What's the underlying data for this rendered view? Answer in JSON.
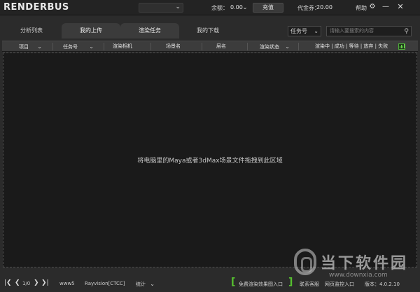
{
  "app": {
    "logo": "RENDERBUS",
    "account_select_value": "",
    "balance_label": "余额：",
    "balance_value": "0.00",
    "recharge_label": "充值",
    "voucher_label": "代金券：",
    "voucher_value": "20.00",
    "help_label": "帮助",
    "icons": [
      "settings-icon",
      "minimize-icon",
      "close-icon"
    ]
  },
  "tabs": [
    {
      "label": "分析列表",
      "active": false
    },
    {
      "label": "我的上传",
      "active": true
    },
    {
      "label": "渲染任务",
      "active": true
    },
    {
      "label": "我的下载",
      "active": false
    }
  ],
  "filter": {
    "select_value": "任务号",
    "search_placeholder": "请输入要搜索的内容"
  },
  "columns": {
    "project": "项目",
    "task_id": "任务号",
    "render_camera": "渲染相机",
    "scene_name": "场景名",
    "layer_name": "层名",
    "render_status": "渲染状态",
    "status_summary": "渲染中 | 成功 | 等待 | 放弃 | 失败"
  },
  "main": {
    "drop_hint": "将电脑里的Maya或者3dMax场景文件拖拽到此区域"
  },
  "statusbar": {
    "page_indicator": "1/0",
    "user": "www5",
    "platform": "Rayvision[CTCC]",
    "stats_label": "统计",
    "free_render_label": "免费渲染效果图入口",
    "contact_label": "联系客服",
    "web_monitor_label": "网页监控入口",
    "version_label": "版本：4.0.2.10"
  },
  "watermark": {
    "text": "当下软件园",
    "url": "www.downxia.com"
  },
  "colors": {
    "accent_green": "#56c12f",
    "background": "#2b2b2b",
    "drop_area": "#1a1a1a"
  }
}
